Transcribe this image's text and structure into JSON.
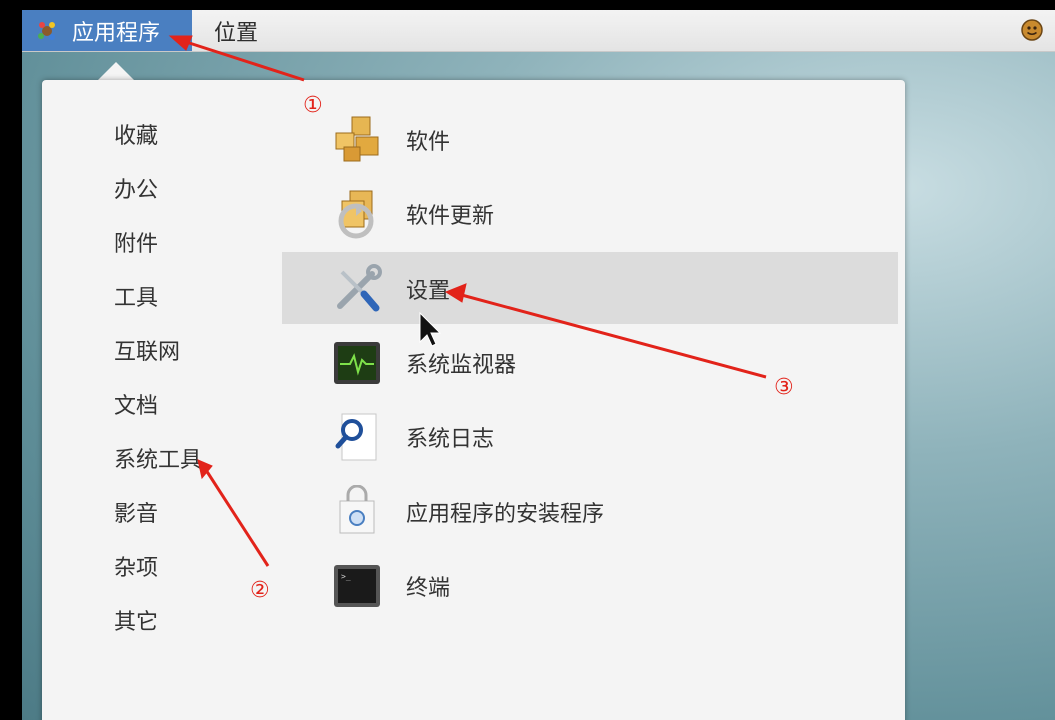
{
  "topbar": {
    "applications_label": "应用程序",
    "places_label": "位置"
  },
  "categories": [
    {
      "label": "收藏"
    },
    {
      "label": "办公"
    },
    {
      "label": "附件"
    },
    {
      "label": "工具"
    },
    {
      "label": "互联网"
    },
    {
      "label": "文档"
    },
    {
      "label": "系统工具"
    },
    {
      "label": "影音"
    },
    {
      "label": "杂项"
    },
    {
      "label": "其它"
    }
  ],
  "apps": [
    {
      "label": "软件",
      "icon": "software-package-icon"
    },
    {
      "label": "软件更新",
      "icon": "software-update-icon"
    },
    {
      "label": "设置",
      "icon": "settings-tools-icon",
      "highlighted": true
    },
    {
      "label": "系统监视器",
      "icon": "system-monitor-icon"
    },
    {
      "label": "系统日志",
      "icon": "system-log-icon"
    },
    {
      "label": "应用程序的安装程序",
      "icon": "app-installer-icon"
    },
    {
      "label": "终端",
      "icon": "terminal-icon"
    }
  ],
  "annotations": {
    "step1": "①",
    "step2": "②",
    "step3": "③",
    "color": "#e2231a"
  }
}
